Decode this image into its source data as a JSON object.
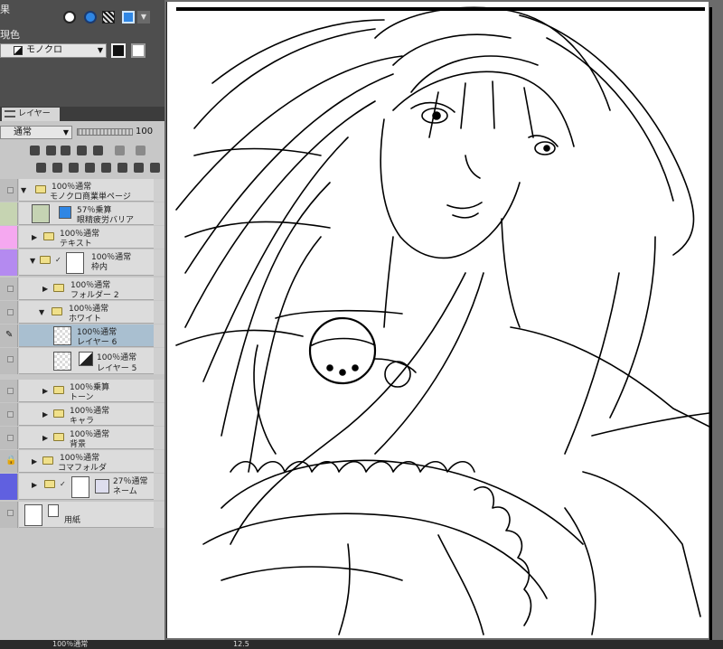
{
  "panels": {
    "effect_label": "果",
    "display_color_label": "現色",
    "mono_select_value": "モノクロ"
  },
  "layer_panel": {
    "tab_label": "レイヤー",
    "blend_mode": "通常",
    "opacity": "100",
    "layers": [
      {
        "mode": "100％通常",
        "name": "モノクロ商業単ページ"
      },
      {
        "mode": "57％乗算",
        "name": "眼精疲労バリア"
      },
      {
        "mode": "100％通常",
        "name": "テキスト"
      },
      {
        "mode": "100％通常",
        "name": "枠内"
      },
      {
        "mode": "100％通常",
        "name": "フォルダー 2"
      },
      {
        "mode": "100％通常",
        "name": "ホワイト"
      },
      {
        "mode": "100％通常",
        "name": "レイヤー 6"
      },
      {
        "mode": "100％通常",
        "name": "レイヤー 5"
      },
      {
        "mode": "100％乗算",
        "name": "トーン"
      },
      {
        "mode": "100％通常",
        "name": "キャラ"
      },
      {
        "mode": "100％通常",
        "name": "背景"
      },
      {
        "mode": "100％通常",
        "name": "コマフォルダ"
      },
      {
        "mode": "27％通常",
        "name": "ネーム"
      },
      {
        "mode": "",
        "name": "用紙"
      }
    ]
  },
  "status_bar": {
    "left_text": "100％通常",
    "zoom": "12.5"
  },
  "colors": {
    "panel_dark": "#4e4e4e",
    "panel_light": "#c7c7c7",
    "selected_layer": "#a9bfd0",
    "accent_blue": "#2f86e4"
  }
}
